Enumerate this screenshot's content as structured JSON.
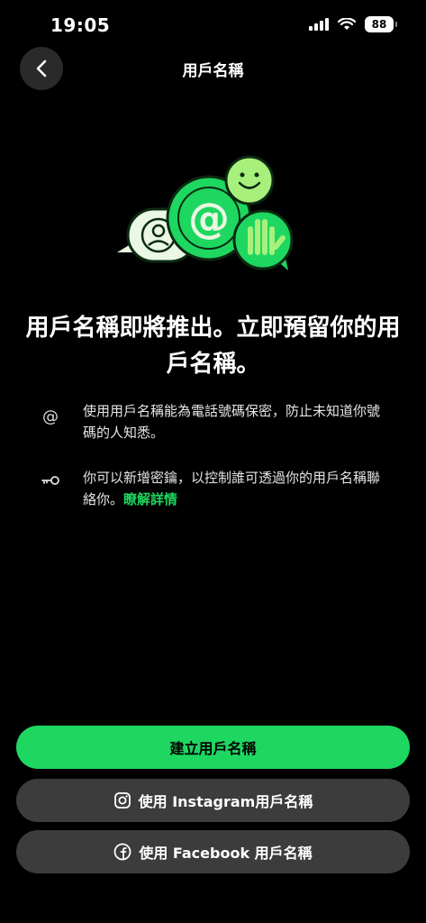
{
  "status": {
    "time": "19:05",
    "battery": "88"
  },
  "header": {
    "title": "用戶名稱",
    "back_icon": "chevron-left-icon"
  },
  "headline": "用戶名稱即將推出。立即預留你的用戶名稱。",
  "info": [
    {
      "icon": "at-icon",
      "text": "使用用戶名稱能為電話號碼保密，防止未知道你號碼的人知悉。"
    },
    {
      "icon": "key-icon",
      "text": "你可以新增密鑰，以控制誰可透過你的用戶名稱聯絡你。",
      "link": "瞭解詳情"
    }
  ],
  "buttons": {
    "create": "建立用戶名稱",
    "instagram": "使用 Instagram用戶名稱",
    "facebook": "使用 Facebook 用戶名稱"
  },
  "colors": {
    "accent": "#1ed760",
    "background": "#000000",
    "secondary_button": "#3c3c3c"
  }
}
